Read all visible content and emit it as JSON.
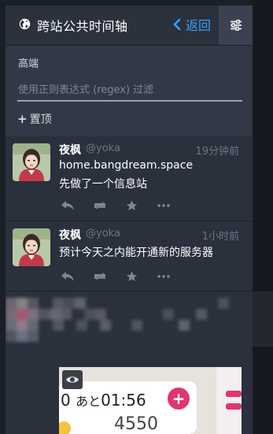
{
  "header": {
    "title": "跨站公共时间轴",
    "back_label": "返回",
    "icons": {
      "globe": "globe-icon",
      "back": "chevron-left-icon",
      "settings": "sliders-icon"
    }
  },
  "filter": {
    "section_label": "高端",
    "regex_placeholder": "使用正则表达式 (regex) 过滤",
    "pin_label": "置顶"
  },
  "posts": [
    {
      "name": "夜枫",
      "handle": "@yoka",
      "time": "19分钟前",
      "lines": [
        "home.bangdream.space",
        "先做了一个信息站"
      ]
    },
    {
      "name": "夜枫",
      "handle": "@yoka",
      "time": "1小时前",
      "lines": [
        "预计今天之内能开通新的服务器"
      ]
    }
  ],
  "media_post": {
    "timer_prefix": "0",
    "timer_label": "あと",
    "timer_value": "01:56",
    "score": "4550"
  },
  "colors": {
    "accent": "#3aa0ff",
    "panel": "#292f3b",
    "filter_bg": "#313846",
    "muted": "#6d7686"
  }
}
